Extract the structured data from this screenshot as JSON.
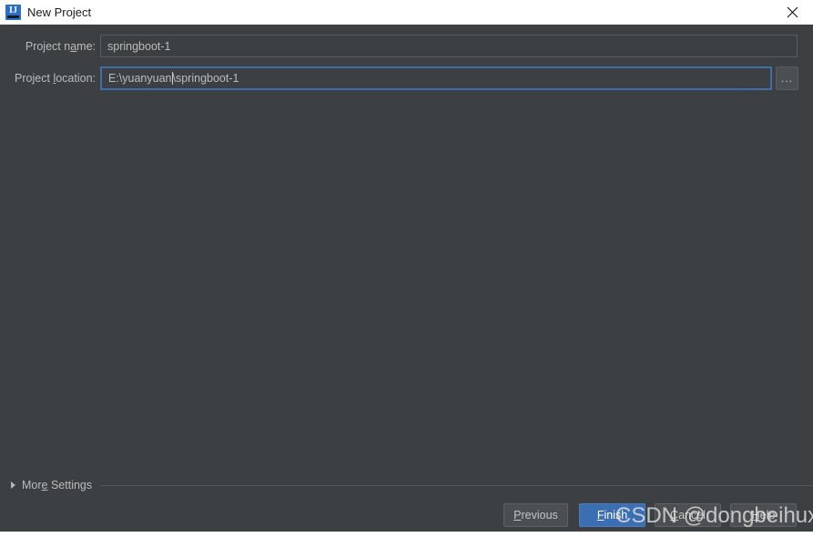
{
  "window": {
    "title": "New Project",
    "icon": "intellij-idea-icon",
    "icon_letters": "IJ",
    "close_icon": "close-icon"
  },
  "form": {
    "project_name": {
      "label_before": "Project n",
      "label_mnemonic": "a",
      "label_after": "me:",
      "value": "springboot-1",
      "placeholder": ""
    },
    "project_location": {
      "label_before": "Project ",
      "label_mnemonic": "l",
      "label_after": "ocation:",
      "value_before_caret": "E:\\yuanyuan",
      "value_after_caret": "\\springboot-1",
      "placeholder": ""
    },
    "browse_button": {
      "label": "...",
      "name": "browse-ellipsis-button"
    }
  },
  "more_settings": {
    "label_before": "Mor",
    "label_mnemonic": "e",
    "label_after": " Settings",
    "expanded": false,
    "arrow_icon": "chevron-right-icon"
  },
  "buttons": {
    "previous": {
      "before": "",
      "mnemonic": "P",
      "after": "revious"
    },
    "finish": {
      "before": "",
      "mnemonic": "F",
      "after": "inish"
    },
    "cancel": {
      "before": "",
      "mnemonic": "C",
      "after": "ancel"
    },
    "help": {
      "before": "",
      "mnemonic": "H",
      "after": "elp"
    }
  },
  "watermark": {
    "text": "CSDN @dongbeihuxiao"
  },
  "colors": {
    "background": "#3c4043",
    "titlebar": "#ffffff",
    "accent": "#3c6eb4",
    "focus_ring": "#3e6fab",
    "text": "#bbbbbb"
  }
}
